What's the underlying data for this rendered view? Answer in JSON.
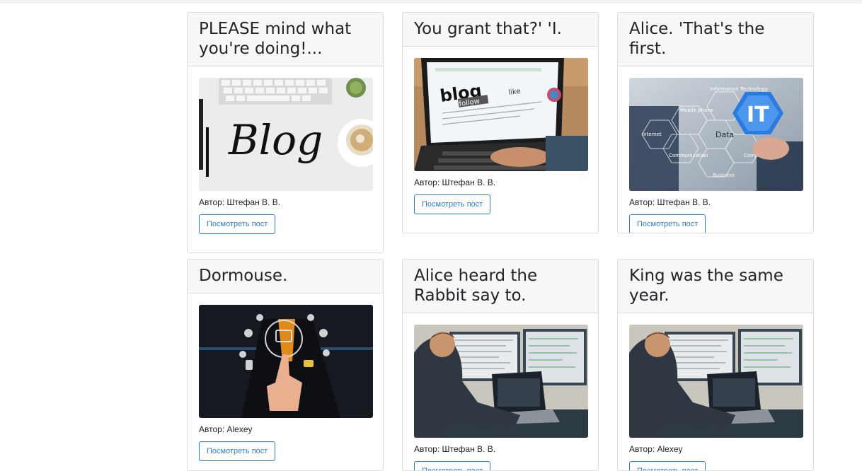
{
  "posts": [
    {
      "title": "PLEASE mind what you're doing!...",
      "author": "Автор: Штефан В. В.",
      "button": "Посмотреть пост",
      "image": "blog-lettering-desk"
    },
    {
      "title": "You grant that?' 'I.",
      "author": "Автор: Штефан В. В.",
      "button": "Посмотреть пост",
      "image": "laptop-blog-screen"
    },
    {
      "title": "Alice. 'That's the first.",
      "author": "Автор: Штефан В. В.",
      "button": "Посмотреть пост",
      "image": "it-hexagon-network"
    },
    {
      "title": "Dormouse.",
      "author": "Автор: Alexey",
      "button": "Посмотреть пост",
      "image": "businessman-touch-icons"
    },
    {
      "title": "Alice heard the Rabbit say to.",
      "author": "Автор: Штефан В. В.",
      "button": "Посмотреть пост",
      "image": "developer-monitors"
    },
    {
      "title": "King was the same year.",
      "author": "Автор: Alexey",
      "button": "Посмотреть пост",
      "image": "developer-monitors"
    }
  ],
  "image_text": {
    "blog_word": "Blog",
    "laptop_blog": "blog",
    "laptop_follow": "follow",
    "laptop_like": "like",
    "it_label": "IT",
    "it_data": "Data",
    "it_mobile": "Mobile phone",
    "it_info": "Information Technology",
    "it_internet": "Internet",
    "it_communication": "Communication",
    "it_computer": "Computer",
    "it_business": "Business"
  }
}
